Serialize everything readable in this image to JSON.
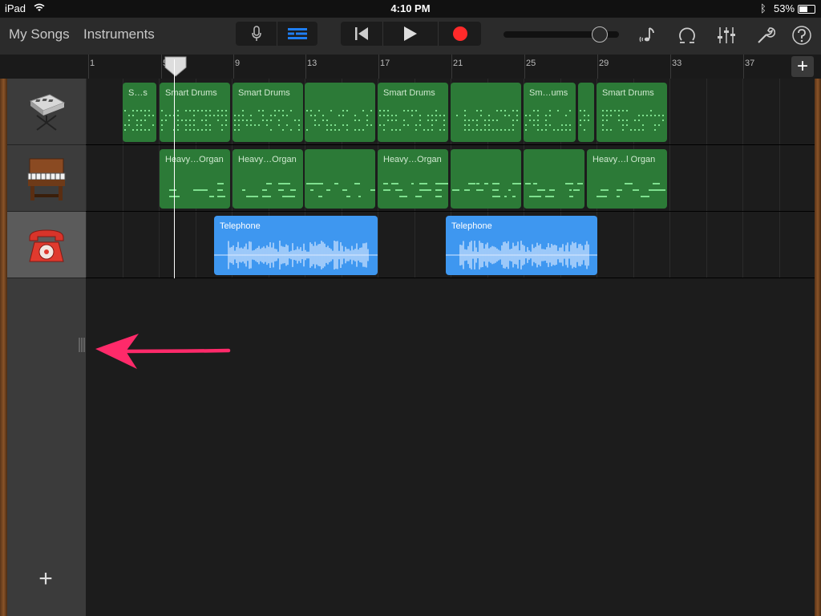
{
  "status": {
    "carrier": "iPad",
    "time": "4:10 PM",
    "battery": "53%",
    "battery_level": 0.53
  },
  "nav": {
    "my_songs": "My Songs",
    "instruments": "Instruments"
  },
  "toolbar": {
    "icons": [
      "microphone-icon",
      "tracks-view-icon",
      "rewind-icon",
      "play-icon",
      "record-icon",
      "master-volume-slider",
      "note-settings-icon",
      "loop-icon",
      "mixer-icon",
      "wrench-icon",
      "help-icon"
    ],
    "accent": "#1f7ef2",
    "record_color": "#ff2a2a"
  },
  "ruler": {
    "bars": [
      "1",
      "5",
      "9",
      "13",
      "17",
      "21",
      "25",
      "29",
      "33",
      "37"
    ],
    "add_label": "+"
  },
  "tracks": [
    {
      "name": "drum-machine",
      "regions": [
        {
          "label": "S…s"
        },
        {
          "label": "Smart Drums"
        },
        {
          "label": "Smart Drums"
        },
        {
          "label": ""
        },
        {
          "label": "Smart Drums"
        },
        {
          "label": ""
        },
        {
          "label": "Sm…ums"
        },
        {
          "label": ""
        },
        {
          "label": "Smart Drums"
        }
      ]
    },
    {
      "name": "organ",
      "regions": [
        {
          "label": "Heavy…Organ"
        },
        {
          "label": "Heavy…Organ"
        },
        {
          "label": ""
        },
        {
          "label": "Heavy…Organ"
        },
        {
          "label": ""
        },
        {
          "label": ""
        },
        {
          "label": "Heavy…l Organ"
        }
      ]
    },
    {
      "name": "telephone",
      "regions": [
        {
          "label": "Telephone"
        },
        {
          "label": "Telephone"
        }
      ]
    }
  ],
  "add_track_label": "+",
  "annotation_color": "#ff2a6a"
}
